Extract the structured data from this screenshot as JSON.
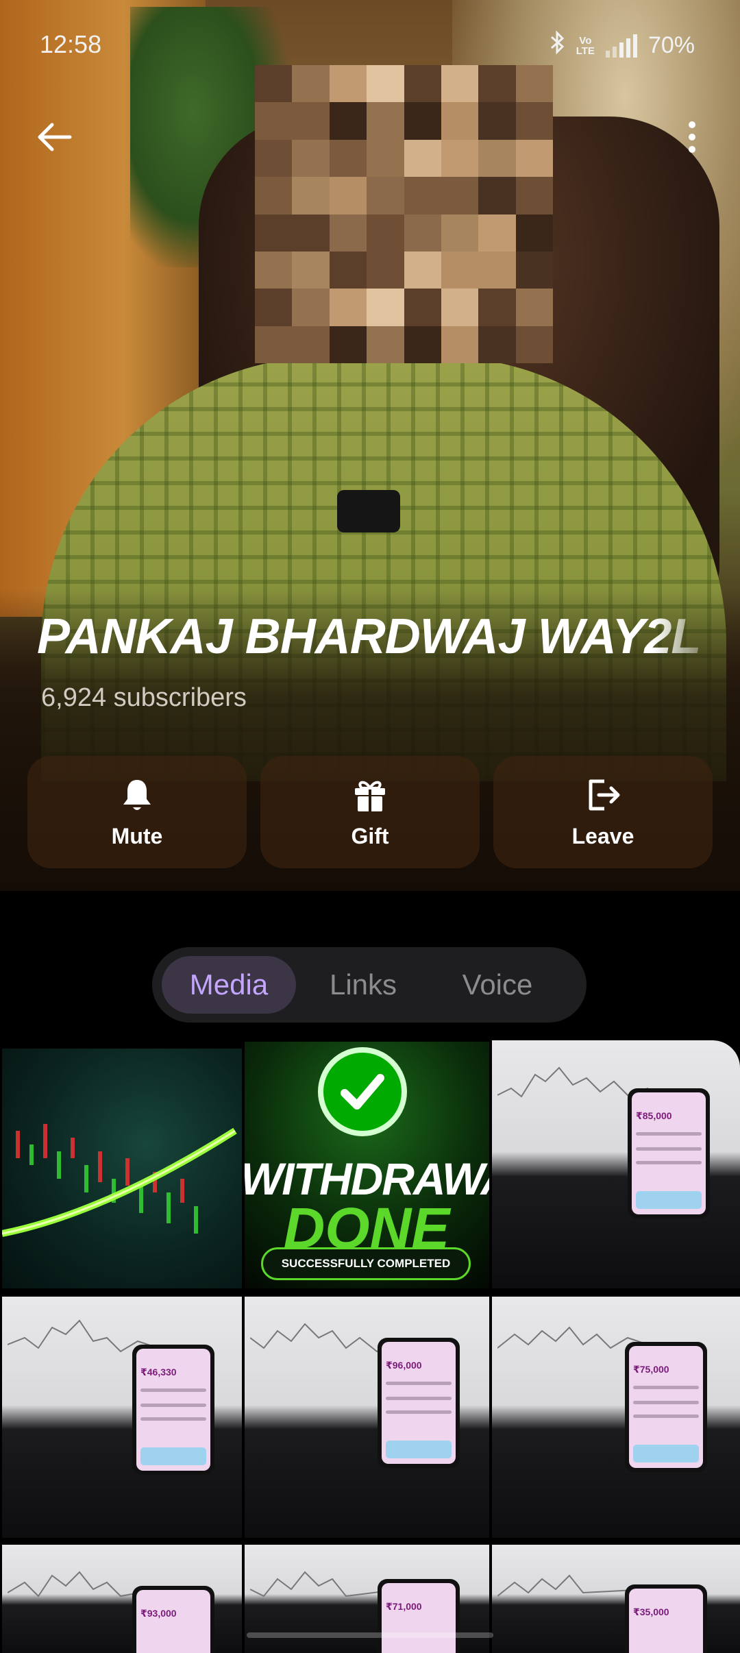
{
  "status_bar": {
    "time": "12:58",
    "volte_top": "Vo",
    "volte_bottom": "LTE",
    "battery": "70%"
  },
  "channel": {
    "name": "PANKAJ BHARDWAJ WAY2L",
    "subscribers": "6,924 subscribers"
  },
  "actions": [
    {
      "label": "Mute",
      "icon": "bell-icon"
    },
    {
      "label": "Gift",
      "icon": "gift-icon"
    },
    {
      "label": "Leave",
      "icon": "leave-icon"
    }
  ],
  "tabs": [
    {
      "label": "Media",
      "active": true
    },
    {
      "label": "Links",
      "active": false
    },
    {
      "label": "Voice",
      "active": false
    }
  ],
  "media": {
    "withdraw_line1": "WITHDRAWAL",
    "withdraw_line2": "DONE",
    "withdraw_banner": "SUCCESSFULLY COMPLETED",
    "amounts": [
      "₹85,000",
      "₹46,330",
      "₹96,000",
      "₹75,000",
      "₹93,000",
      "₹71,000",
      "₹35,000"
    ]
  },
  "colors": {
    "accent_active_tab_text": "#c4a6ff",
    "active_tab_bg": "#3b3545",
    "tab_bar_bg": "#1e1e20",
    "withdraw_green": "#5bd82a"
  }
}
